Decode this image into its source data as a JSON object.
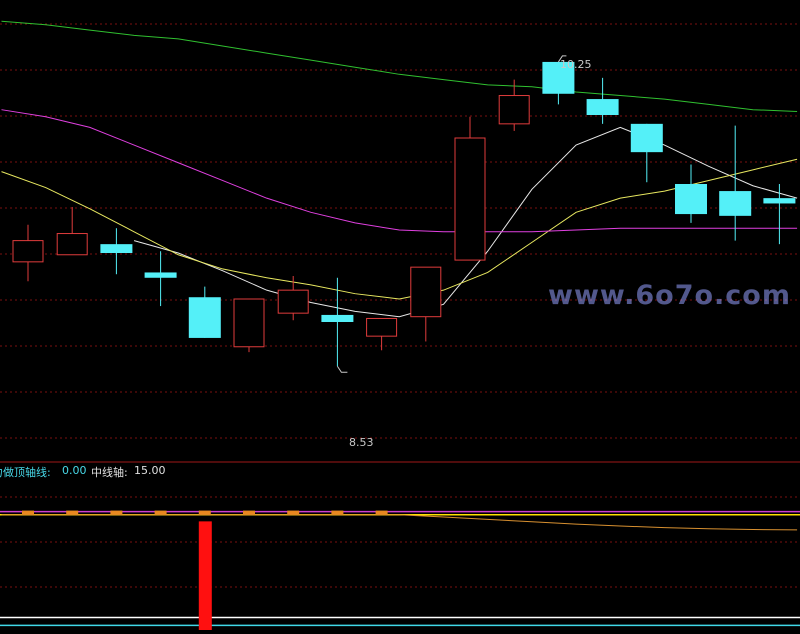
{
  "watermark": "www.6o7o.com",
  "chart_data": [
    {
      "type": "candlestick",
      "title": "",
      "ylim": [
        8.0,
        10.6
      ],
      "high_label": "10.25",
      "low_label": "8.53",
      "candles": [
        {
          "open": 9.12,
          "close": 9.24,
          "high": 9.33,
          "low": 9.01
        },
        {
          "open": 9.16,
          "close": 9.28,
          "high": 9.43,
          "low": 9.16
        },
        {
          "open": 9.22,
          "close": 9.17,
          "high": 9.31,
          "low": 9.05
        },
        {
          "open": 9.06,
          "close": 9.03,
          "high": 9.18,
          "low": 8.87
        },
        {
          "open": 8.92,
          "close": 8.69,
          "high": 8.98,
          "low": 8.69
        },
        {
          "open": 8.64,
          "close": 8.91,
          "high": 8.91,
          "low": 8.61
        },
        {
          "open": 8.83,
          "close": 8.96,
          "high": 9.04,
          "low": 8.79
        },
        {
          "open": 8.82,
          "close": 8.78,
          "high": 9.03,
          "low": 8.53
        },
        {
          "open": 8.7,
          "close": 8.8,
          "high": 8.8,
          "low": 8.62
        },
        {
          "open": 8.81,
          "close": 9.09,
          "high": 9.09,
          "low": 8.67
        },
        {
          "open": 9.13,
          "close": 9.82,
          "high": 9.94,
          "low": 9.13
        },
        {
          "open": 9.9,
          "close": 10.06,
          "high": 10.15,
          "low": 9.86
        },
        {
          "open": 10.25,
          "close": 10.07,
          "high": 10.25,
          "low": 10.01
        },
        {
          "open": 10.04,
          "close": 9.95,
          "high": 10.16,
          "low": 9.9
        },
        {
          "open": 9.9,
          "close": 9.74,
          "high": 9.9,
          "low": 9.57
        },
        {
          "open": 9.56,
          "close": 9.39,
          "high": 9.67,
          "low": 9.34
        },
        {
          "open": 9.52,
          "close": 9.38,
          "high": 9.89,
          "low": 9.24
        },
        {
          "open": 9.48,
          "close": 9.45,
          "high": 9.56,
          "low": 9.22
        }
      ],
      "ma_lines": [
        {
          "color": "#e8e8e8",
          "values": [
            null,
            null,
            null,
            9.24,
            9.17,
            9.07,
            8.96,
            8.89,
            8.84,
            8.81,
            8.88,
            9.18,
            9.53,
            9.78,
            9.88,
            9.78,
            9.66,
            9.55,
            9.48
          ]
        },
        {
          "color": "#e8e860",
          "values": [
            9.63,
            9.54,
            9.42,
            9.29,
            9.16,
            9.08,
            9.03,
            8.99,
            8.94,
            8.91,
            8.96,
            9.06,
            9.23,
            9.4,
            9.48,
            9.52,
            9.58,
            9.64,
            9.7
          ]
        },
        {
          "color": "#e040e0",
          "values": [
            9.98,
            9.94,
            9.88,
            9.78,
            9.68,
            9.58,
            9.48,
            9.4,
            9.34,
            9.3,
            9.29,
            9.29,
            9.29,
            9.3,
            9.31,
            9.31,
            9.31,
            9.31,
            9.31
          ]
        },
        {
          "color": "#30c030",
          "values": [
            10.48,
            10.46,
            10.43,
            10.4,
            10.38,
            10.34,
            10.3,
            10.26,
            10.22,
            10.18,
            10.15,
            10.12,
            10.11,
            10.08,
            10.06,
            10.04,
            10.01,
            9.98,
            9.97
          ]
        }
      ]
    },
    {
      "type": "bar",
      "legend": [
        {
          "label": "力做顶轴线:",
          "value": "0.00",
          "color": "#48d8e8"
        },
        {
          "label": "中线轴:",
          "value": "15.00",
          "color": "#e0e0e0"
        }
      ],
      "ylim": [
        -1,
        18
      ],
      "signal_bar": {
        "index": 4,
        "value": 15.0,
        "color": "#ff1010"
      },
      "small_marks": [
        0,
        1,
        2,
        3,
        4,
        5,
        6,
        7,
        8
      ],
      "reference_lines": [
        {
          "value": 14.2,
          "color": "#d040d0"
        },
        {
          "value": 13.8,
          "color": "#ffe000"
        },
        {
          "value": 0.6,
          "color": "#ffffff"
        },
        {
          "value": -0.4,
          "color": "#40d8e8"
        }
      ],
      "decay_line": {
        "color": "#d89030",
        "values": [
          13.8,
          13.8,
          13.8,
          13.8,
          13.8,
          13.8,
          13.8,
          13.8,
          13.8,
          13.8,
          13.5,
          13.2,
          12.9,
          12.6,
          12.35,
          12.15,
          12.0,
          11.9,
          11.85
        ]
      }
    }
  ]
}
